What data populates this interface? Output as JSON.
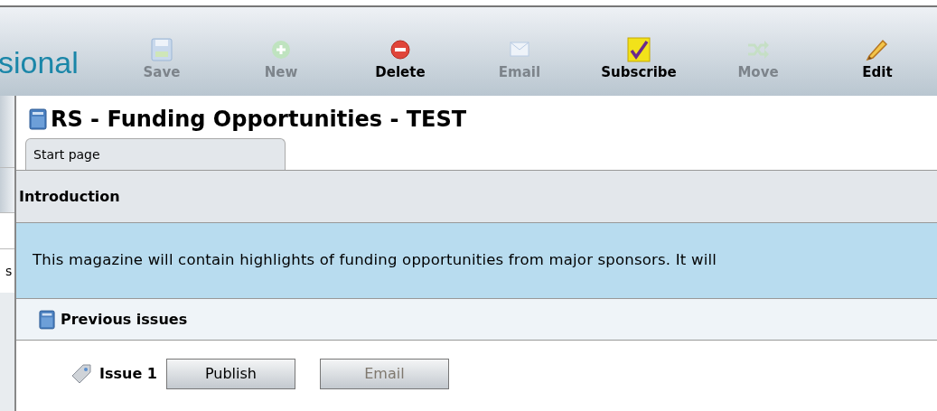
{
  "logo": {
    "text": "sional"
  },
  "toolbar": [
    {
      "label": "Save",
      "kind": "save",
      "disabled": true
    },
    {
      "label": "New",
      "kind": "new",
      "disabled": true
    },
    {
      "label": "Delete",
      "kind": "delete",
      "disabled": false
    },
    {
      "label": "Email",
      "kind": "email",
      "disabled": true
    },
    {
      "label": "Subscribe",
      "kind": "subscribe",
      "disabled": false
    },
    {
      "label": "Move",
      "kind": "move",
      "disabled": true
    },
    {
      "label": "Edit",
      "kind": "edit",
      "disabled": false
    }
  ],
  "sidebar": {
    "fragment": "s"
  },
  "page": {
    "title": "RS - Funding Opportunities - TEST"
  },
  "tabs": [
    {
      "label": "Start page",
      "selected": true
    }
  ],
  "introduction": {
    "heading": "Introduction",
    "text": "This magazine will contain highlights of funding opportunities from major sponsors. It will"
  },
  "previous_issues": {
    "heading": "Previous issues",
    "items": [
      {
        "label": "Issue 1",
        "buttons": [
          {
            "label": "Publish",
            "disabled": false
          },
          {
            "label": "Email",
            "disabled": true
          }
        ]
      }
    ]
  }
}
